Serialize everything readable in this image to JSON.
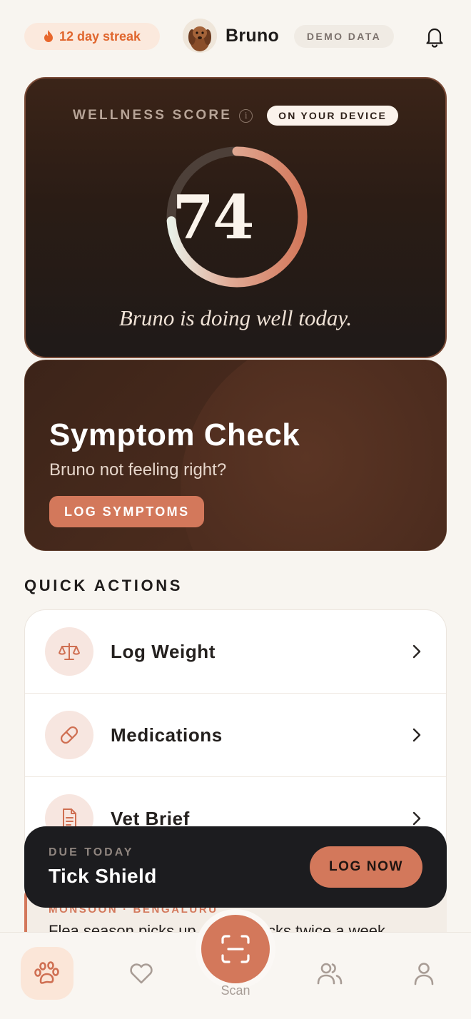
{
  "header": {
    "streak_label": "12 day streak",
    "pet_name": "Bruno",
    "demo_label": "DEMO DATA"
  },
  "wellness": {
    "title": "WELLNESS SCORE",
    "badge": "ON YOUR DEVICE",
    "score": "74",
    "score_fraction": 0.74,
    "message": "Bruno is doing well today."
  },
  "symptom": {
    "title": "Symptom Check",
    "subtitle": "Bruno not feeling right?",
    "button": "LOG SYMPTOMS"
  },
  "quick_actions": {
    "title": "QUICK ACTIONS",
    "items": [
      {
        "label": "Log Weight",
        "icon": "scale-icon"
      },
      {
        "label": "Medications",
        "icon": "pill-icon"
      },
      {
        "label": "Vet Brief",
        "icon": "document-icon"
      }
    ]
  },
  "tip": {
    "kicker": "MONSOON · BENGALURU",
    "text": "Flea season picks up — do checks twice a week."
  },
  "due": {
    "kicker": "DUE TODAY",
    "title": "Tick Shield",
    "button": "LOG NOW"
  },
  "nav": {
    "scan_label": "Scan"
  },
  "colors": {
    "accent": "#d3785b",
    "streak": "#e0662e",
    "dark_card": "#2a1c15"
  }
}
